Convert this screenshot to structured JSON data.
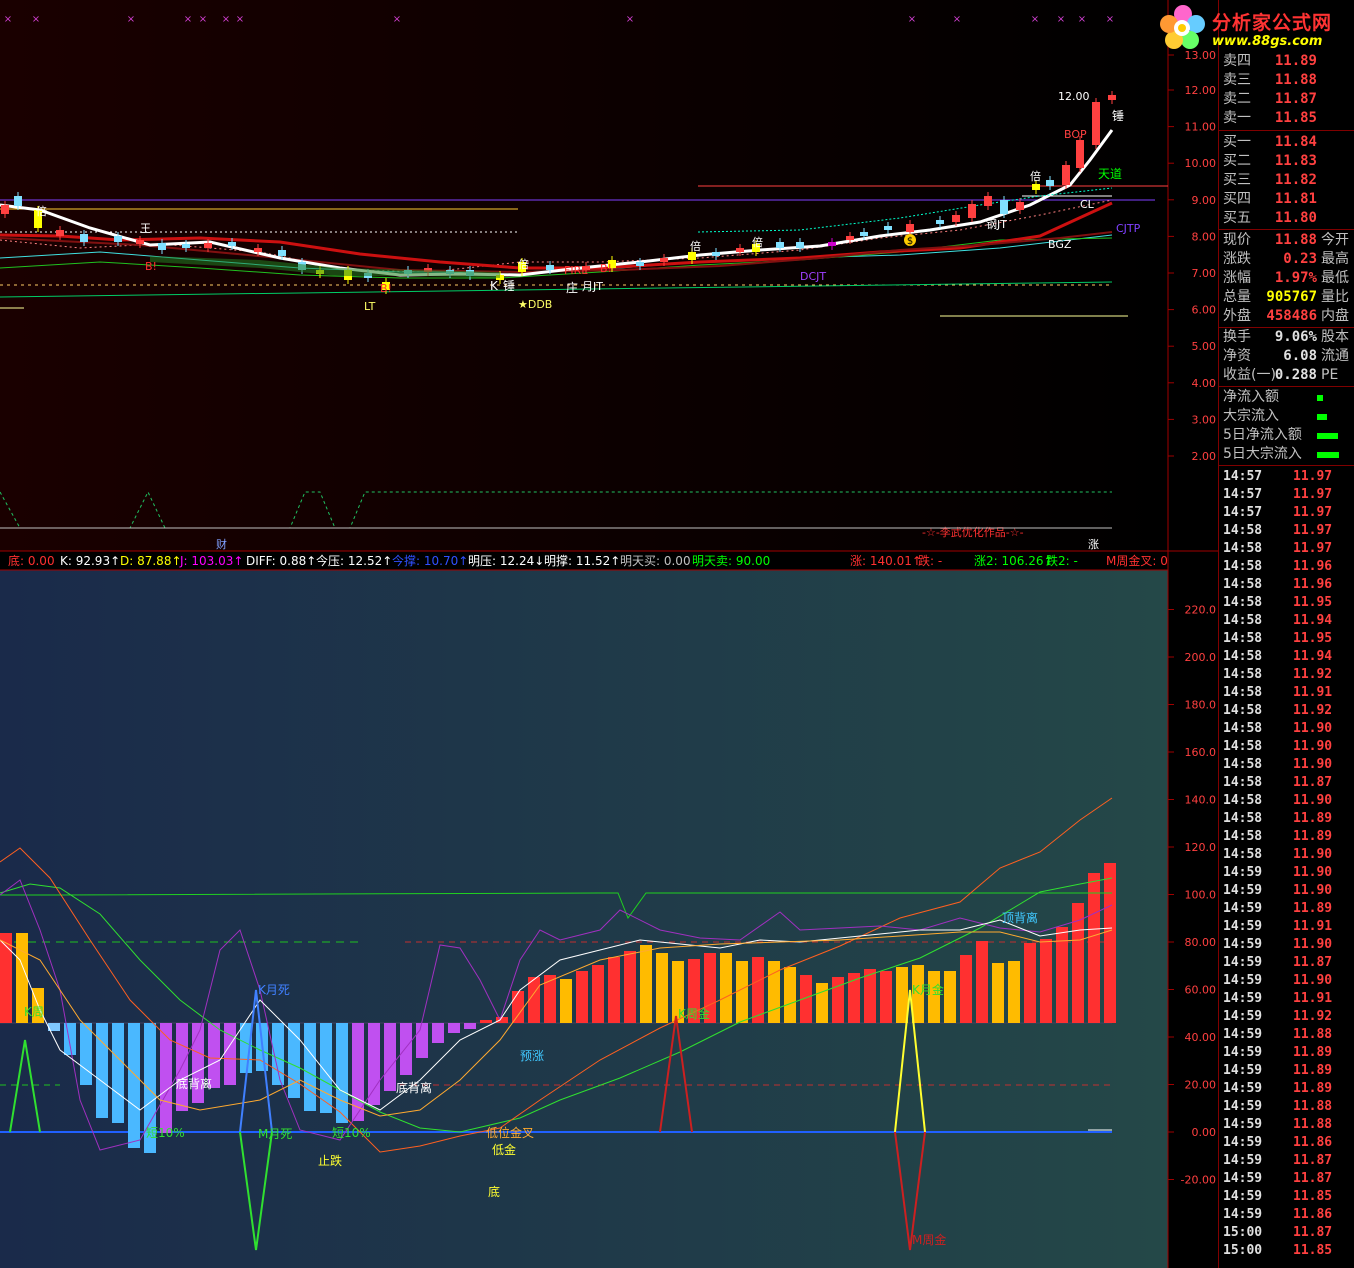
{
  "logo": {
    "title": "分析家公式网",
    "url": "www.88gs.com"
  },
  "top_right_cut": "IIIBIIAI",
  "price_axis": [
    "13.00",
    "12.00",
    "11.00",
    "10.00",
    "9.00",
    "8.00",
    "7.00",
    "6.00",
    "5.00",
    "4.00",
    "3.00",
    "2.00"
  ],
  "indicator_axis": [
    "220.0",
    "200.0",
    "180.0",
    "160.0",
    "140.0",
    "120.0",
    "100.0",
    "80.00",
    "60.00",
    "40.00",
    "20.00",
    "0.00",
    "-20.00"
  ],
  "chart_labels": {
    "high_price": "12.00",
    "chui": "锤",
    "bop": "BOP",
    "tiandao": "天道",
    "cl": "CL",
    "cjtp": "CJTP",
    "bgz": "BGZ",
    "fjt": "钢JT",
    "dcjt": "DCJT",
    "bei1": "倍",
    "bei2": "倍",
    "bei3": "倍",
    "bei4": "倍",
    "bei5": "倍",
    "b1": "B!",
    "b2": "B!",
    "b3": "B!",
    "wang": "王",
    "lt": "LT",
    "k": "K",
    "chui2": "锤",
    "ddb": "★DDB",
    "zhuang": "庄",
    "yuejt": "月JT",
    "fire": "FIRE",
    "cai": "财",
    "zhang": "涨",
    "author": "-☆-李武优化作品-☆-",
    "s_badge": "$"
  },
  "info_bar": [
    {
      "text": "底: 0.00",
      "color": "#ff3030"
    },
    {
      "text": "K: 92.93↑",
      "color": "#ffffff"
    },
    {
      "text": "D: 87.88↑",
      "color": "#ffff00"
    },
    {
      "text": "J: 103.03↑",
      "color": "#ff00ff"
    },
    {
      "text": "DIFF: 0.88↑",
      "color": "#ffffff"
    },
    {
      "text": "今压: 12.52↑",
      "color": "#ffffff"
    },
    {
      "text": "今撑: 10.70↑",
      "color": "#3050ff"
    },
    {
      "text": "明压: 12.24↓",
      "color": "#ffffff"
    },
    {
      "text": "明撑: 11.52↑",
      "color": "#ffffff"
    },
    {
      "text": "明天买: 0.00",
      "color": "#c0c0c0"
    },
    {
      "text": "明天卖: 90.00",
      "color": "#00ff00"
    },
    {
      "text": "涨: 140.01↑",
      "color": "#ff3030"
    },
    {
      "text": "跌: -",
      "color": "#ff3030"
    },
    {
      "text": "涨2: 106.26↑",
      "color": "#00ff00"
    },
    {
      "text": "跌2: -",
      "color": "#00ff00"
    },
    {
      "text": "M周金叉: 0",
      "color": "#ff3030"
    }
  ],
  "indicator_labels": {
    "k_month_die": "K月死",
    "k_week_gold": "K周金",
    "k_month_gold": "K月金",
    "k_week": "K周",
    "m_month_die": "M月死",
    "m_week_gold": "M周金",
    "short10": "短10%",
    "short10b": "短10%",
    "bottom_div1": "底背离",
    "bottom_div2": "底背离",
    "top_div": "顶背离",
    "yuzhang": "预涨",
    "zhidie": "止跌",
    "low_gold_cross": "低位金叉",
    "low_gold": "低金",
    "di": "底"
  },
  "order_book": {
    "sells": [
      {
        "label": "卖四",
        "price": "11.89"
      },
      {
        "label": "卖三",
        "price": "11.88"
      },
      {
        "label": "卖二",
        "price": "11.87"
      },
      {
        "label": "卖一",
        "price": "11.85"
      }
    ],
    "buys": [
      {
        "label": "买一",
        "price": "11.84"
      },
      {
        "label": "买二",
        "price": "11.83"
      },
      {
        "label": "买三",
        "price": "11.82"
      },
      {
        "label": "买四",
        "price": "11.81"
      },
      {
        "label": "买五",
        "price": "11.80"
      }
    ]
  },
  "quote": [
    {
      "label": "现价",
      "value": "11.88",
      "color": "#ff4040",
      "extra": "今开"
    },
    {
      "label": "涨跌",
      "value": "0.23",
      "color": "#ff4040",
      "extra": "最高"
    },
    {
      "label": "涨幅",
      "value": "1.97%",
      "color": "#ff4040",
      "extra": "最低"
    },
    {
      "label": "总量",
      "value": "905767",
      "color": "#ffff00",
      "extra": "量比"
    },
    {
      "label": "外盘",
      "value": "458486",
      "color": "#ff4040",
      "extra": "内盘"
    },
    {
      "label": "换手",
      "value": "9.06%",
      "color": "#e0e0e0",
      "extra": "股本"
    },
    {
      "label": "净资",
      "value": "6.08",
      "color": "#e0e0e0",
      "extra": "流通"
    },
    {
      "label": "收益(一)",
      "value": "0.288",
      "color": "#e0e0e0",
      "extra": "PE"
    }
  ],
  "flows": [
    {
      "label": "净流入额",
      "bar": 0.2
    },
    {
      "label": "大宗流入",
      "bar": 0.35
    },
    {
      "label": "5日净流入额",
      "bar": 0.75
    },
    {
      "label": "5日大宗流入",
      "bar": 0.8
    }
  ],
  "ticks": [
    {
      "t": "14:57",
      "p": "11.97"
    },
    {
      "t": "14:57",
      "p": "11.97"
    },
    {
      "t": "14:57",
      "p": "11.97"
    },
    {
      "t": "14:58",
      "p": "11.97"
    },
    {
      "t": "14:58",
      "p": "11.97"
    },
    {
      "t": "14:58",
      "p": "11.96"
    },
    {
      "t": "14:58",
      "p": "11.96"
    },
    {
      "t": "14:58",
      "p": "11.95"
    },
    {
      "t": "14:58",
      "p": "11.94"
    },
    {
      "t": "14:58",
      "p": "11.95"
    },
    {
      "t": "14:58",
      "p": "11.94"
    },
    {
      "t": "14:58",
      "p": "11.92"
    },
    {
      "t": "14:58",
      "p": "11.91"
    },
    {
      "t": "14:58",
      "p": "11.92"
    },
    {
      "t": "14:58",
      "p": "11.90"
    },
    {
      "t": "14:58",
      "p": "11.90"
    },
    {
      "t": "14:58",
      "p": "11.90"
    },
    {
      "t": "14:58",
      "p": "11.87"
    },
    {
      "t": "14:58",
      "p": "11.90"
    },
    {
      "t": "14:58",
      "p": "11.89"
    },
    {
      "t": "14:58",
      "p": "11.89"
    },
    {
      "t": "14:58",
      "p": "11.90"
    },
    {
      "t": "14:59",
      "p": "11.90"
    },
    {
      "t": "14:59",
      "p": "11.90"
    },
    {
      "t": "14:59",
      "p": "11.89"
    },
    {
      "t": "14:59",
      "p": "11.91"
    },
    {
      "t": "14:59",
      "p": "11.90"
    },
    {
      "t": "14:59",
      "p": "11.87"
    },
    {
      "t": "14:59",
      "p": "11.90"
    },
    {
      "t": "14:59",
      "p": "11.91"
    },
    {
      "t": "14:59",
      "p": "11.92"
    },
    {
      "t": "14:59",
      "p": "11.88"
    },
    {
      "t": "14:59",
      "p": "11.89"
    },
    {
      "t": "14:59",
      "p": "11.89"
    },
    {
      "t": "14:59",
      "p": "11.89"
    },
    {
      "t": "14:59",
      "p": "11.88"
    },
    {
      "t": "14:59",
      "p": "11.88"
    },
    {
      "t": "14:59",
      "p": "11.86"
    },
    {
      "t": "14:59",
      "p": "11.87"
    },
    {
      "t": "14:59",
      "p": "11.87"
    },
    {
      "t": "14:59",
      "p": "11.85"
    },
    {
      "t": "14:59",
      "p": "11.86"
    },
    {
      "t": "15:00",
      "p": "11.87"
    },
    {
      "t": "15:00",
      "p": "11.85"
    }
  ]
}
